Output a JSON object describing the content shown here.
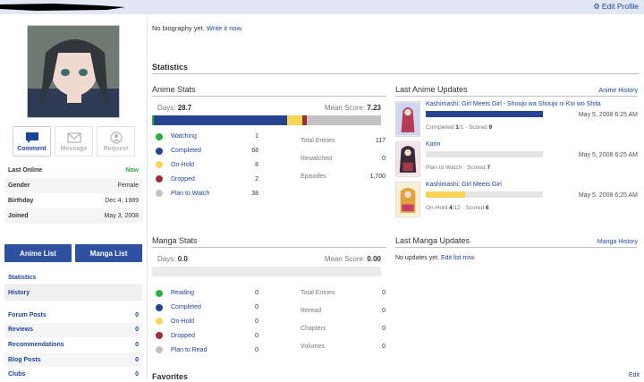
{
  "topbar": {
    "edit_profile": "Edit Profile"
  },
  "sidebar": {
    "buttons": {
      "comment": "Comment",
      "message": "Message",
      "request": "Request"
    },
    "info": [
      {
        "key": "Last Online",
        "value": "Now"
      },
      {
        "key": "Gender",
        "value": "Female"
      },
      {
        "key": "Birthday",
        "value": "Dec 4, 1989"
      },
      {
        "key": "Joined",
        "value": "May 3, 2008"
      }
    ],
    "anime_list": "Anime List",
    "manga_list": "Manga List",
    "links": [
      "Statistics",
      "History"
    ],
    "counts": [
      {
        "label": "Forum Posts",
        "value": "0"
      },
      {
        "label": "Reviews",
        "value": "0"
      },
      {
        "label": "Recommendations",
        "value": "0"
      },
      {
        "label": "Blog Posts",
        "value": "0"
      },
      {
        "label": "Clubs",
        "value": "0"
      }
    ]
  },
  "main": {
    "bio_text": "No biography yet.",
    "bio_link": "Write it now.",
    "statistics": "Statistics",
    "anime_stats": {
      "title": "Anime Stats",
      "days_label": "Days:",
      "days": "28.7",
      "mean_label": "Mean Score:",
      "mean": "7.23",
      "legend": [
        {
          "label": "Watching",
          "value": "1",
          "color": "#2db039"
        },
        {
          "label": "Completed",
          "value": "68",
          "color": "#26448f"
        },
        {
          "label": "On-Hold",
          "value": "8",
          "color": "#f9d457"
        },
        {
          "label": "Dropped",
          "value": "2",
          "color": "#a12f31"
        },
        {
          "label": "Plan to Watch",
          "value": "38",
          "color": "#c3c3c3"
        }
      ],
      "totals": [
        {
          "label": "Total Entries",
          "value": "117"
        },
        {
          "label": "Rewatched",
          "value": "0"
        },
        {
          "label": "Episodes",
          "value": "1,700"
        }
      ]
    },
    "manga_stats": {
      "title": "Manga Stats",
      "days_label": "Days:",
      "days": "0.0",
      "mean_label": "Mean Score:",
      "mean": "0.00",
      "legend": [
        {
          "label": "Reading",
          "value": "0",
          "color": "#2db039"
        },
        {
          "label": "Completed",
          "value": "0",
          "color": "#26448f"
        },
        {
          "label": "On-Hold",
          "value": "0",
          "color": "#f9d457"
        },
        {
          "label": "Dropped",
          "value": "0",
          "color": "#a12f31"
        },
        {
          "label": "Plan to Read",
          "value": "0",
          "color": "#c3c3c3"
        }
      ],
      "totals": [
        {
          "label": "Total Entries",
          "value": "0"
        },
        {
          "label": "Reread",
          "value": "0"
        },
        {
          "label": "Chapters",
          "value": "0"
        },
        {
          "label": "Volumes",
          "value": "0"
        }
      ]
    },
    "anime_updates": {
      "title": "Last Anime Updates",
      "history_link": "Anime History",
      "items": [
        {
          "title": "Kashimashi: Girl Meets Girl - Shoujo wa Shoujo ni Koi wo Shita",
          "date": "May 5, 2008 6:25 AM",
          "status": "Completed",
          "progress": "1",
          "total": "/1",
          "score_label": "· Scored",
          "score": "9",
          "fill": 1.0,
          "fill_color": "#26448f"
        },
        {
          "title": "Karin",
          "date": "May 5, 2008 6:25 AM",
          "status": "Plan to Watch",
          "progress": "",
          "total": "",
          "score_label": "· Scored",
          "score": "7",
          "fill": 0.0,
          "fill_color": "#c3c3c3"
        },
        {
          "title": "Kashimashi: Girl Meets Girl",
          "date": "May 5, 2008 6:25 AM",
          "status": "On-Hold",
          "progress": "4",
          "total": "/12",
          "score_label": "· Scored",
          "score": "6",
          "fill": 0.333,
          "fill_color": "#f9d457"
        }
      ]
    },
    "manga_updates": {
      "title": "Last Manga Updates",
      "history_link": "Manga History",
      "none_text": "No updates yet.",
      "edit_link": "Edit list now."
    },
    "favorites": "Favorites",
    "favorites_edit": "Edit"
  }
}
